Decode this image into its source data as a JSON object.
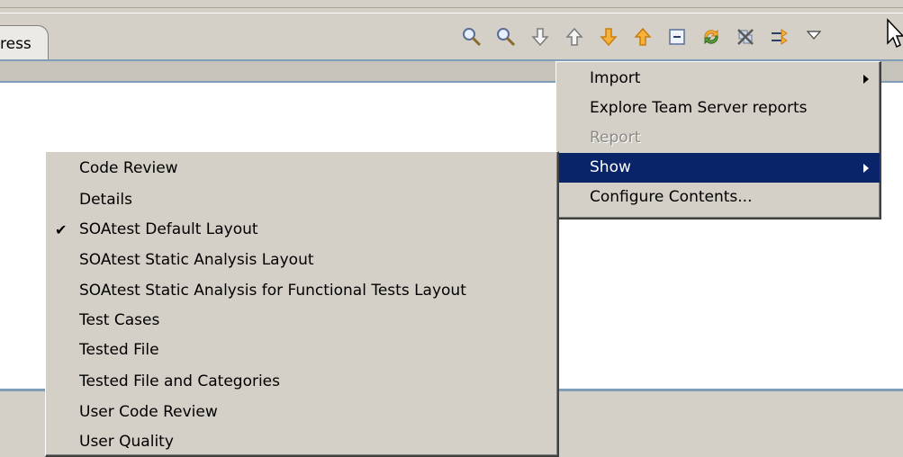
{
  "tab": {
    "label": "ress"
  },
  "toolbar": {
    "icons": [
      "zoom-in-icon",
      "zoom-out-icon",
      "next-outline-icon",
      "prev-outline-icon",
      "next-arrow-icon",
      "prev-arrow-icon",
      "collapse-all-icon",
      "sync-icon",
      "remove-all-icon",
      "link-icon",
      "view-menu-icon"
    ]
  },
  "main_menu": {
    "items": [
      {
        "label": "Import",
        "submenu": true,
        "enabled": true
      },
      {
        "label": "Explore Team Server reports",
        "submenu": false,
        "enabled": true
      },
      {
        "label": "Report",
        "submenu": false,
        "enabled": false
      },
      {
        "label": "Show",
        "submenu": true,
        "enabled": true,
        "highlighted": true
      },
      {
        "label": "Configure Contents...",
        "submenu": false,
        "enabled": true
      }
    ]
  },
  "show_menu": {
    "items": [
      {
        "label": "Code Review",
        "checked": false
      },
      {
        "label": "Details",
        "checked": false
      },
      {
        "label": "SOAtest Default Layout",
        "checked": true
      },
      {
        "label": "SOAtest Static Analysis Layout",
        "checked": false
      },
      {
        "label": "SOAtest Static Analysis for Functional Tests Layout",
        "checked": false
      },
      {
        "label": "Test Cases",
        "checked": false
      },
      {
        "label": "Tested File",
        "checked": false
      },
      {
        "label": "Tested File and Categories",
        "checked": false
      },
      {
        "label": "User Code Review",
        "checked": false
      },
      {
        "label": "User Quality",
        "checked": false
      }
    ]
  },
  "colors": {
    "highlight": "#0a246a",
    "menu_bg": "#d4d0c8",
    "accent_orange": "#f5a623"
  }
}
